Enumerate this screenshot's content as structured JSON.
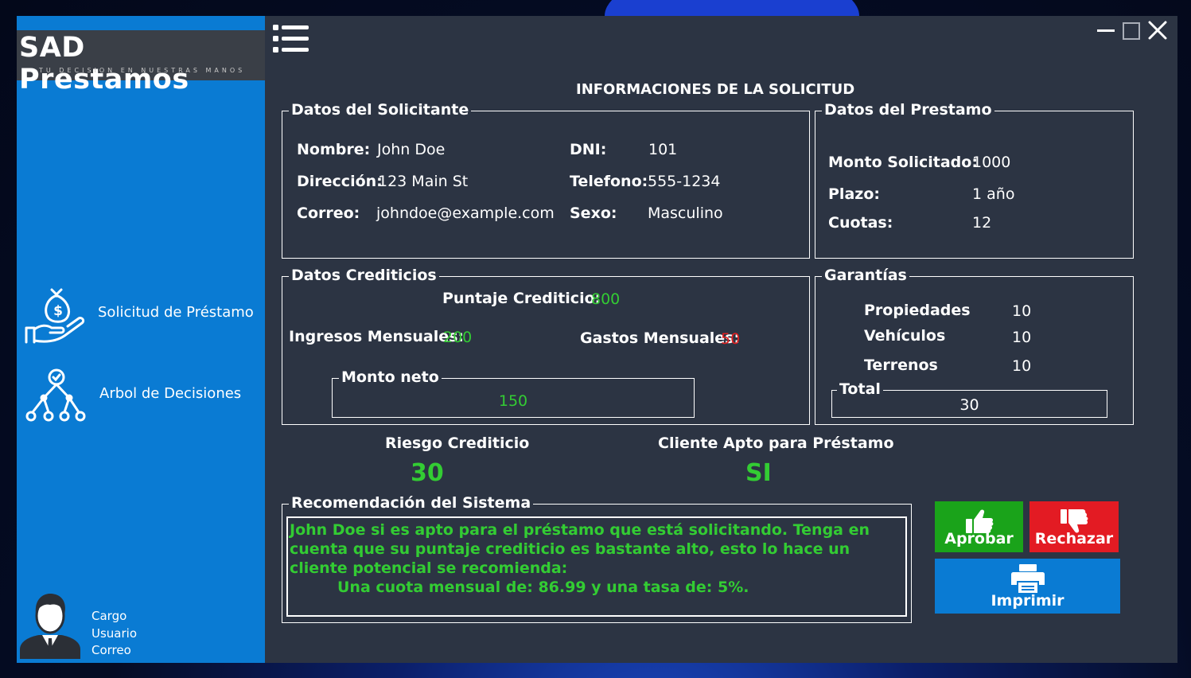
{
  "app": {
    "logo_title": "SAD Prestamos",
    "logo_tagline": "TU DECISION EN NUESTRAS MANOS"
  },
  "sidebar": {
    "items": [
      {
        "label": "Solicitud de Préstamo",
        "icon": "money-bag-hand-icon"
      },
      {
        "label": "Arbol de Decisiones",
        "icon": "decision-tree-icon"
      }
    ],
    "user": {
      "cargo": "Cargo",
      "usuario": "Usuario",
      "correo": "Correo",
      "icon": "user-avatar-icon"
    }
  },
  "header": {
    "title": "INFORMACIONES DE LA SOLICITUD"
  },
  "solicitante": {
    "title": "Datos del Solicitante",
    "nombre_label": "Nombre:",
    "nombre": "John Doe",
    "direccion_label": "Dirección:",
    "direccion": "123 Main St",
    "correo_label": "Correo:",
    "correo": "johndoe@example.com",
    "dni_label": "DNI:",
    "dni": "101",
    "telefono_label": "Telefono:",
    "telefono": "555-1234",
    "sexo_label": "Sexo:",
    "sexo": "Masculino"
  },
  "prestamo": {
    "title": "Datos del Prestamo",
    "monto_label": "Monto Solicitado:",
    "monto": "1000",
    "plazo_label": "Plazo:",
    "plazo": "1 año",
    "cuotas_label": "Cuotas:",
    "cuotas": "12"
  },
  "crediticios": {
    "title": "Datos Crediticios",
    "puntaje_label": "Puntaje Crediticio:",
    "puntaje": "800",
    "ingresos_label": "Ingresos Mensuales:",
    "ingresos": "200",
    "gastos_label": "Gastos Mensuales:",
    "gastos": "50",
    "monto_neto_title": "Monto neto",
    "monto_neto": "150"
  },
  "garantias": {
    "title": "Garantías",
    "propiedades_label": "Propiedades",
    "propiedades": "10",
    "vehiculos_label": "Vehículos",
    "vehiculos": "10",
    "terrenos_label": "Terrenos",
    "terrenos": "10",
    "total_title": "Total",
    "total": "30"
  },
  "riesgo": {
    "label": "Riesgo Crediticio",
    "value": "30"
  },
  "apto": {
    "label": "Cliente Apto para Préstamo",
    "value": "SI"
  },
  "recomendacion": {
    "title": "Recomendación del Sistema",
    "text": "John Doe si es apto para el préstamo que está solicitando. Tenga en cuenta que su puntaje crediticio es bastante alto, esto lo hace un cliente potencial se recomienda:",
    "detail": "Una cuota mensual de: 86.99 y una tasa de: 5%."
  },
  "actions": {
    "aprobar": "Aprobar",
    "rechazar": "Rechazar",
    "imprimir": "Imprimir"
  },
  "colors": {
    "sidebar": "#0a7bd3",
    "panel": "#2c3443",
    "positive": "#33cc33",
    "negative": "#e02020",
    "approve": "#1aa31a",
    "reject": "#e31b23"
  }
}
